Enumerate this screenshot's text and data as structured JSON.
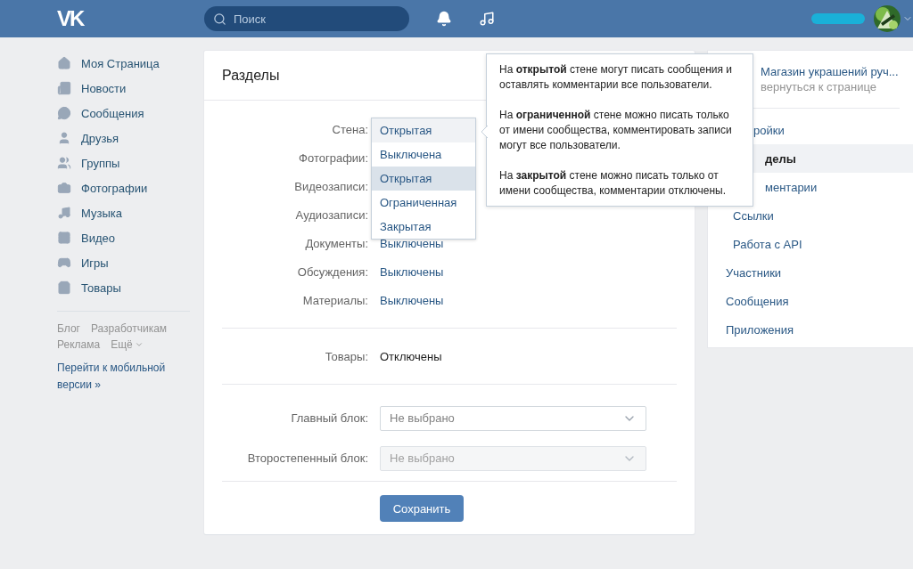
{
  "header": {
    "logo": "VK",
    "search": {
      "placeholder": "Поиск"
    }
  },
  "sidebar": {
    "items": [
      {
        "label": "Моя Страница"
      },
      {
        "label": "Новости"
      },
      {
        "label": "Сообщения"
      },
      {
        "label": "Друзья"
      },
      {
        "label": "Группы"
      },
      {
        "label": "Фотографии"
      },
      {
        "label": "Музыка"
      },
      {
        "label": "Видео"
      },
      {
        "label": "Игры"
      },
      {
        "label": "Товары"
      }
    ],
    "footer_links": [
      "Блог",
      "Разработчикам",
      "Реклама",
      "Ещё"
    ],
    "mobile_link": "Перейти к мобильной версии »"
  },
  "panel": {
    "title": "Разделы",
    "rows": [
      {
        "label": "Стена:"
      },
      {
        "label": "Фотографии:"
      },
      {
        "label": "Видеозаписи:"
      },
      {
        "label": "Аудиозаписи:"
      },
      {
        "label": "Документы:",
        "value": "Выключены"
      },
      {
        "label": "Обсуждения:",
        "value": "Выключены"
      },
      {
        "label": "Материалы:",
        "value": "Выключены"
      }
    ],
    "goods": {
      "label": "Товары:",
      "value": "Отключены"
    },
    "selects": [
      {
        "label": "Главный блок:",
        "placeholder": "Не выбрано",
        "disabled": false
      },
      {
        "label": "Второстепенный блок:",
        "placeholder": "Не выбрано",
        "disabled": true
      }
    ],
    "save_button": "Сохранить",
    "dropdown": {
      "current": "Открытая",
      "options": [
        {
          "label": "Выключена",
          "selected": false
        },
        {
          "label": "Открытая",
          "selected": true
        },
        {
          "label": "Ограниченная",
          "selected": false
        },
        {
          "label": "Закрытая",
          "selected": false
        }
      ]
    }
  },
  "tooltip": {
    "paragraphs": [
      "На **открытой** стене могут писать сообщения и оставлять комментарии все пользователи.",
      "На **ограниченной** стене можно писать только от имени сообщества, комментировать записи могут все пользователи.",
      "На **закрытой** стене можно писать только от имени сообщества, комментарии отключены."
    ]
  },
  "right_menu": {
    "title": "Магазин украшений руч...",
    "subtitle": "вернуться к странице",
    "items": [
      {
        "label": "ройки",
        "cut": true,
        "selected": false,
        "children": [
          {
            "label": "делы",
            "cut": true,
            "selected": true
          },
          {
            "label": "ментарии",
            "cut": true,
            "selected": false
          },
          {
            "label": "Ссылки",
            "cut": false,
            "selected": false
          },
          {
            "label": "Работа с API",
            "cut": false,
            "selected": false
          }
        ]
      },
      {
        "label": "Участники",
        "cut": false,
        "selected": false
      },
      {
        "label": "Сообщения",
        "cut": false,
        "selected": false
      },
      {
        "label": "Приложения",
        "cut": false,
        "selected": false
      }
    ]
  }
}
